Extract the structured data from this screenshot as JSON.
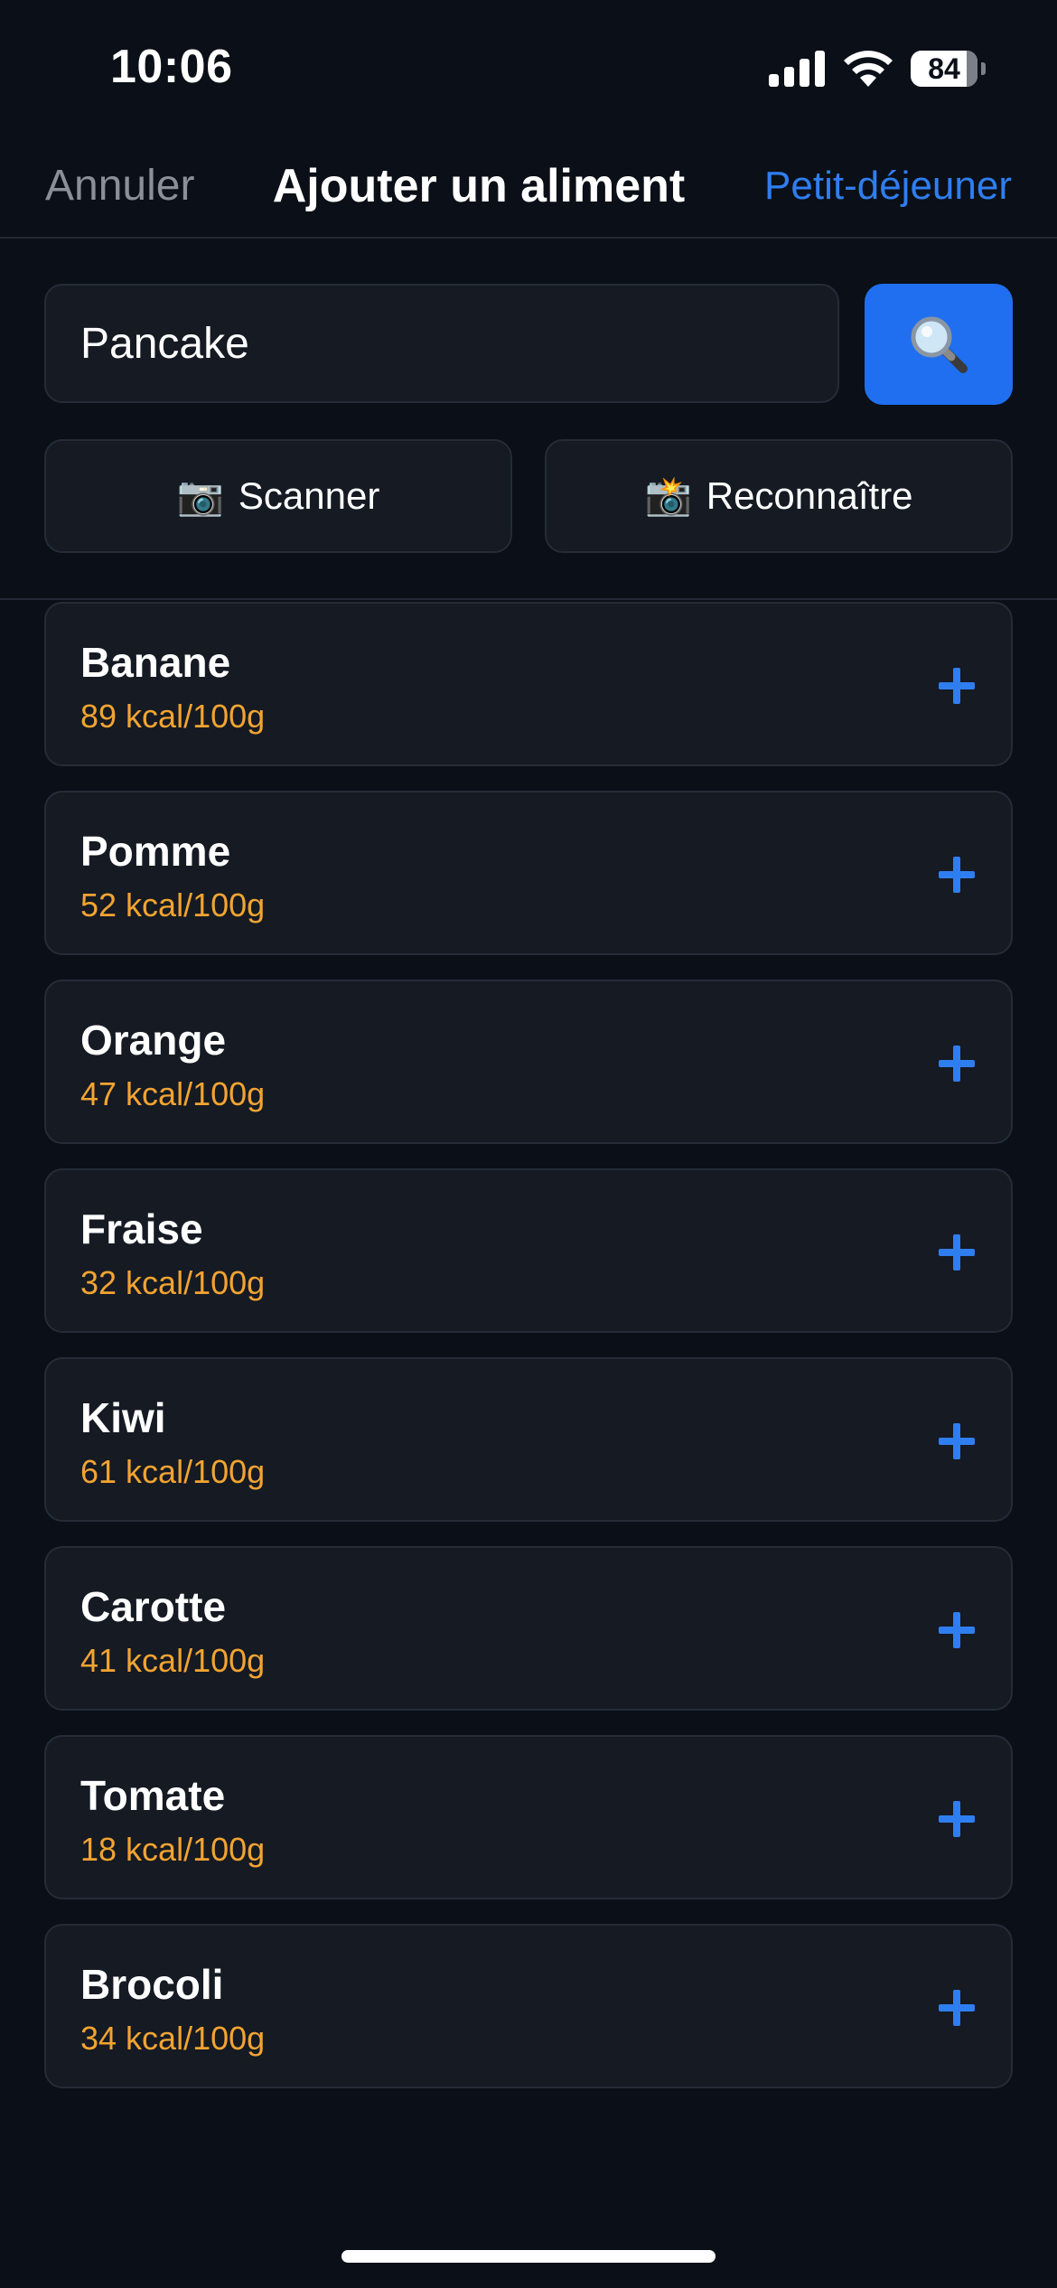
{
  "status_bar": {
    "time": "10:06",
    "battery_level": "84",
    "battery_fraction": 0.84
  },
  "nav": {
    "cancel_label": "Annuler",
    "title": "Ajouter un aliment",
    "meal_label": "Petit-déjeuner"
  },
  "search": {
    "value": "Pancake",
    "button_icon": "search-icon"
  },
  "actions": {
    "scan_icon": "📷",
    "scan_label": "Scanner",
    "recognize_icon": "📸",
    "recognize_label": "Reconnaître"
  },
  "foods": [
    {
      "name": "Banane",
      "kcal": "89 kcal/100g"
    },
    {
      "name": "Pomme",
      "kcal": "52 kcal/100g"
    },
    {
      "name": "Orange",
      "kcal": "47 kcal/100g"
    },
    {
      "name": "Fraise",
      "kcal": "32 kcal/100g"
    },
    {
      "name": "Kiwi",
      "kcal": "61 kcal/100g"
    },
    {
      "name": "Carotte",
      "kcal": "41 kcal/100g"
    },
    {
      "name": "Tomate",
      "kcal": "18 kcal/100g"
    },
    {
      "name": "Brocoli",
      "kcal": "34 kcal/100g"
    }
  ],
  "colors": {
    "background": "#0b0f17",
    "card": "#151a23",
    "accent": "#2f7ef0",
    "kcal": "#f2a431"
  }
}
